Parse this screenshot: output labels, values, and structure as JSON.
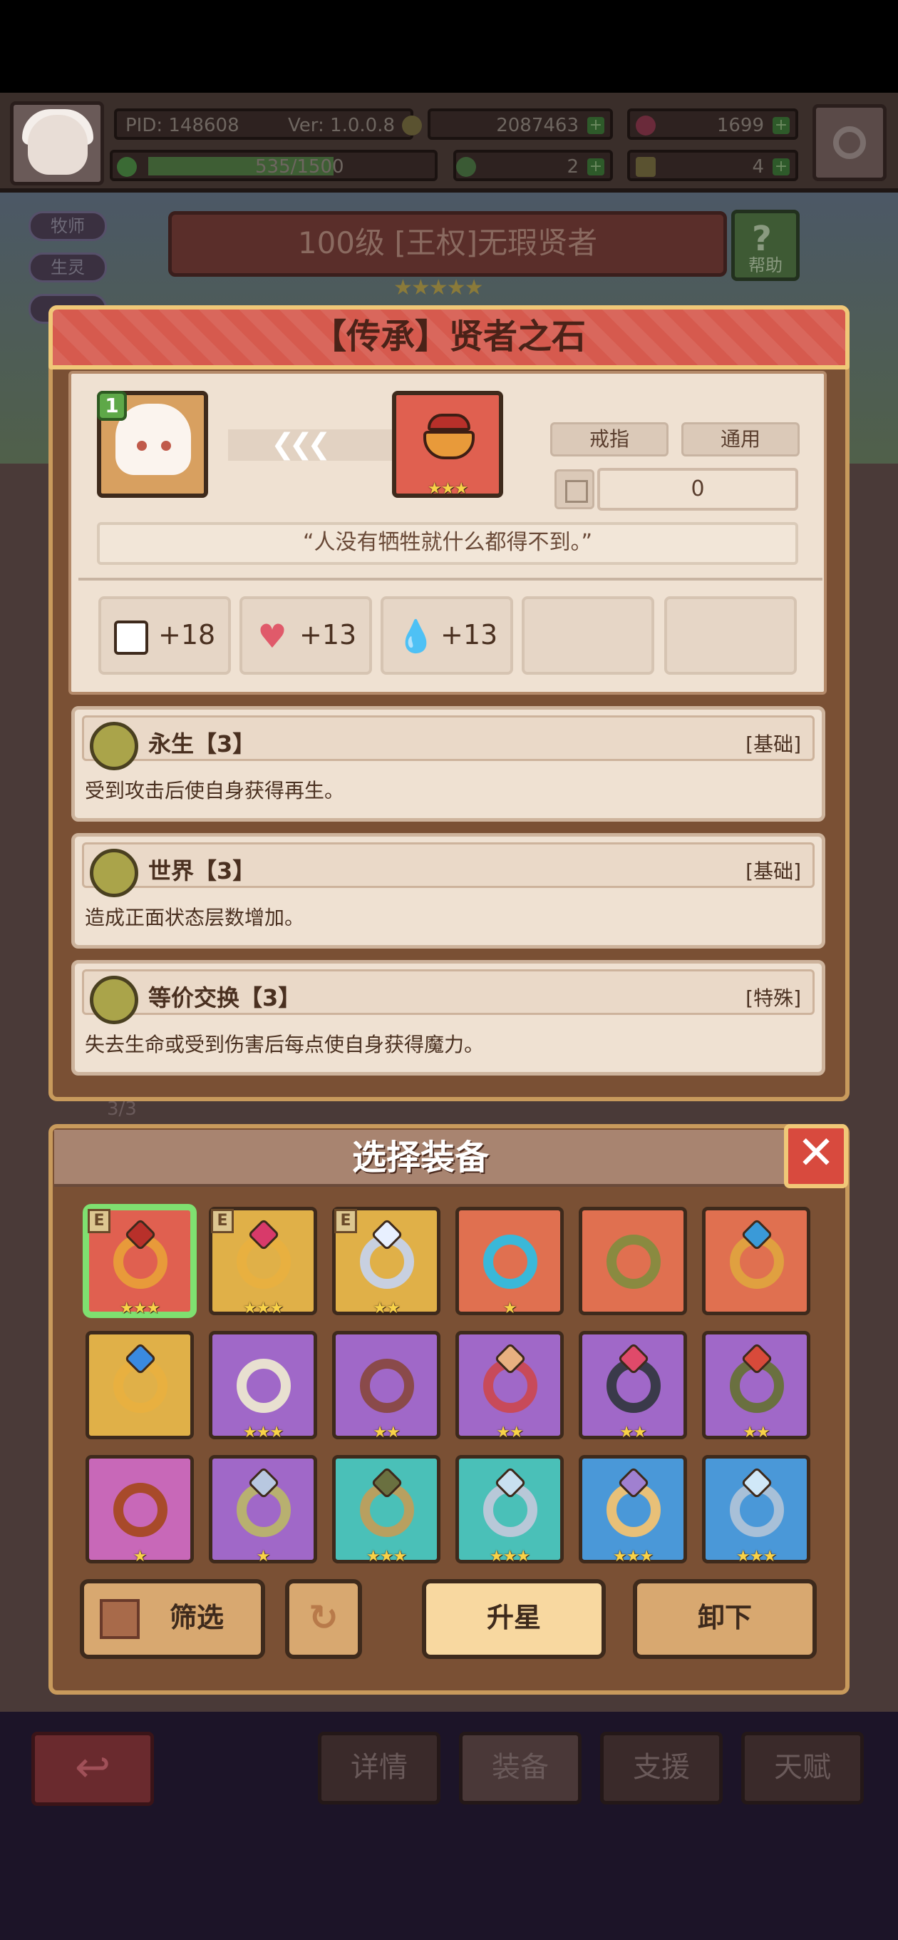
{
  "hud": {
    "pid": "PID: 148608",
    "version": "Ver: 1.0.0.8",
    "gold": "2087463",
    "gems": "1699",
    "xp": "535/1500",
    "clover": "2",
    "keys": "4"
  },
  "background": {
    "tags": [
      "牧师",
      "生灵"
    ],
    "hero_banner": "100级 [王权]无瑕贤者",
    "help_label": "帮助",
    "stage": "3/3",
    "nav": {
      "details": "详情",
      "equip": "装备",
      "support": "支援",
      "talent": "天赋"
    }
  },
  "item": {
    "title": "【传承】贤者之石",
    "char_level": "1",
    "item_stars": "★★★",
    "type_tag": "戒指",
    "scope_tag": "通用",
    "count": "0",
    "quote": "“人没有牺牲就什么都得不到。”",
    "stats": [
      {
        "icon": "book-icon",
        "value": "+18"
      },
      {
        "icon": "heart-icon",
        "value": "+13"
      },
      {
        "icon": "water-drop-icon",
        "value": "+13"
      }
    ],
    "skills": [
      {
        "name": "永生【3】",
        "type": "[基础]",
        "desc": "受到攻击后使自身获得再生。"
      },
      {
        "name": "世界【3】",
        "type": "[基础]",
        "desc": "造成正面状态层数增加。"
      },
      {
        "name": "等价交换【3】",
        "type": "[特殊]",
        "desc": "失去生命或受到伤害后每点使自身获得魔力。"
      }
    ]
  },
  "chooser": {
    "title": "选择装备",
    "close": "✕",
    "slots": [
      {
        "stars": "★★★",
        "badge": "E",
        "bg": "#e06050",
        "ring": "#e89a3a",
        "gem": "#b8302a"
      },
      {
        "stars": "★★★",
        "badge": "E",
        "bg": "#e0b048",
        "ring": "#e8b040",
        "gem": "#d83a6a"
      },
      {
        "stars": "★★",
        "badge": "E",
        "bg": "#e0b048",
        "ring": "#c8d0e0",
        "gem": "#e8f0ff"
      },
      {
        "stars": "★",
        "badge": "",
        "bg": "#e07050",
        "ring": "#3ab8d8",
        "gem": ""
      },
      {
        "stars": "",
        "badge": "",
        "bg": "#e07050",
        "ring": "#8a8a40",
        "gem": ""
      },
      {
        "stars": "",
        "badge": "",
        "bg": "#e07050",
        "ring": "#e0a040",
        "gem": "#3a9ad8"
      },
      {
        "stars": "",
        "badge": "",
        "bg": "#e0b048",
        "ring": "#e8b040",
        "gem": "#3a8ae0"
      },
      {
        "stars": "★★★",
        "badge": "",
        "bg": "#a068c8",
        "ring": "#e8e0d0",
        "gem": ""
      },
      {
        "stars": "★★",
        "badge": "",
        "bg": "#a068c8",
        "ring": "#8a4a4a",
        "gem": ""
      },
      {
        "stars": "★★",
        "badge": "",
        "bg": "#a068c8",
        "ring": "#c84a5a",
        "gem": "#e8b080"
      },
      {
        "stars": "★★",
        "badge": "",
        "bg": "#a068c8",
        "ring": "#3a3a4a",
        "gem": "#e04a6a"
      },
      {
        "stars": "★★",
        "badge": "",
        "bg": "#a068c8",
        "ring": "#6a7040",
        "gem": "#d84a3a"
      },
      {
        "stars": "★",
        "badge": "",
        "bg": "#c868b8",
        "ring": "#a84a2a",
        "gem": ""
      },
      {
        "stars": "★",
        "badge": "",
        "bg": "#a068c8",
        "ring": "#b8b070",
        "gem": "#b8c8e0"
      },
      {
        "stars": "★★★",
        "badge": "",
        "bg": "#4ac0b8",
        "ring": "#b8a060",
        "gem": "#6a7040"
      },
      {
        "stars": "★★★",
        "badge": "",
        "bg": "#4ac0b8",
        "ring": "#b8c8d8",
        "gem": "#c8e0f0"
      },
      {
        "stars": "★★★",
        "badge": "",
        "bg": "#4a98d8",
        "ring": "#e8c078",
        "gem": "#a080d0"
      },
      {
        "stars": "★★★",
        "badge": "",
        "bg": "#4a98d8",
        "ring": "#a8c0d8",
        "gem": "#d0e8f8"
      }
    ],
    "buttons": {
      "filter": "筛选",
      "upgrade": "升星",
      "unequip": "卸下"
    }
  }
}
